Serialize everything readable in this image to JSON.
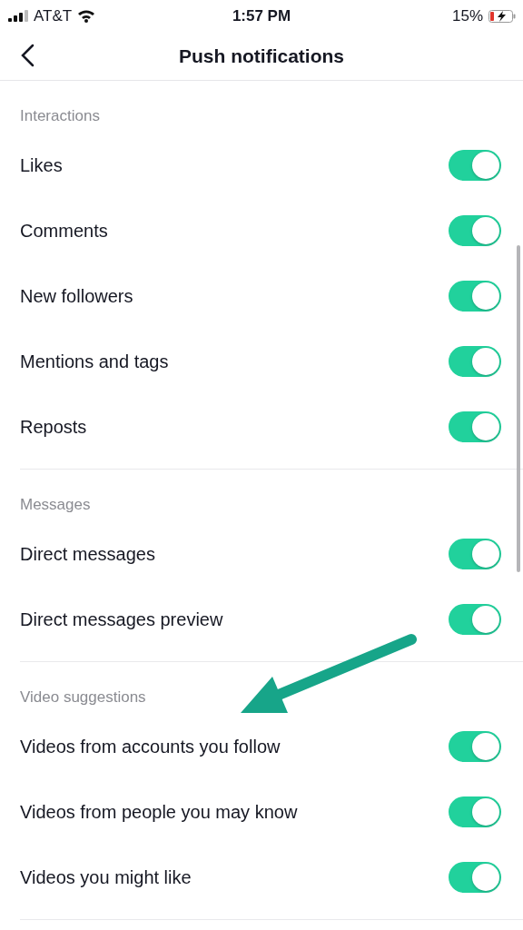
{
  "status_bar": {
    "carrier": "AT&T",
    "time": "1:57 PM",
    "battery": "15%"
  },
  "header": {
    "title": "Push notifications"
  },
  "sections": [
    {
      "title": "Interactions",
      "items": [
        {
          "label": "Likes",
          "on": true
        },
        {
          "label": "Comments",
          "on": true
        },
        {
          "label": "New followers",
          "on": true
        },
        {
          "label": "Mentions and tags",
          "on": true
        },
        {
          "label": "Reposts",
          "on": true
        }
      ]
    },
    {
      "title": "Messages",
      "items": [
        {
          "label": "Direct messages",
          "on": true
        },
        {
          "label": "Direct messages preview",
          "on": true
        }
      ]
    },
    {
      "title": "Video suggestions",
      "items": [
        {
          "label": "Videos from accounts you follow",
          "on": true
        },
        {
          "label": "Videos from people you may know",
          "on": true
        },
        {
          "label": "Videos you might like",
          "on": true
        }
      ]
    }
  ]
}
